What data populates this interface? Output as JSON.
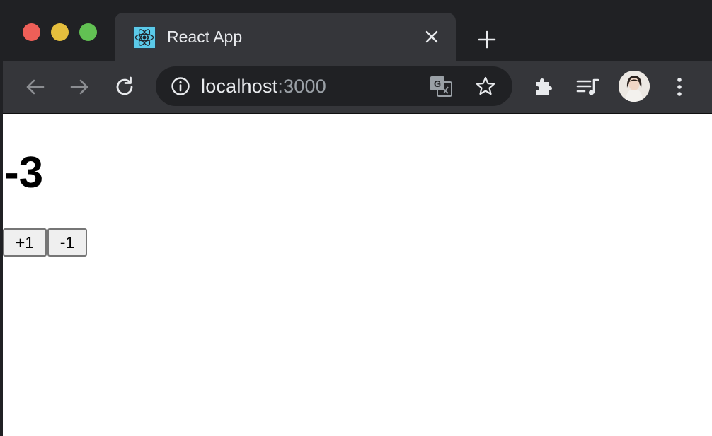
{
  "browser": {
    "tab": {
      "title": "React App",
      "favicon": "react-logo-icon"
    },
    "omnibox": {
      "host": "localhost",
      "port": ":3000"
    },
    "icons": {
      "back": "arrow-left-icon",
      "forward": "arrow-right-icon",
      "reload": "reload-icon",
      "info": "info-icon",
      "translate": "translate-icon",
      "bookmark": "star-icon",
      "extensions": "puzzle-icon",
      "media": "media-queue-icon",
      "menu": "kebab-menu-icon"
    }
  },
  "app": {
    "counter": "-3",
    "buttons": {
      "increment": "+1",
      "decrement": "-1"
    }
  }
}
